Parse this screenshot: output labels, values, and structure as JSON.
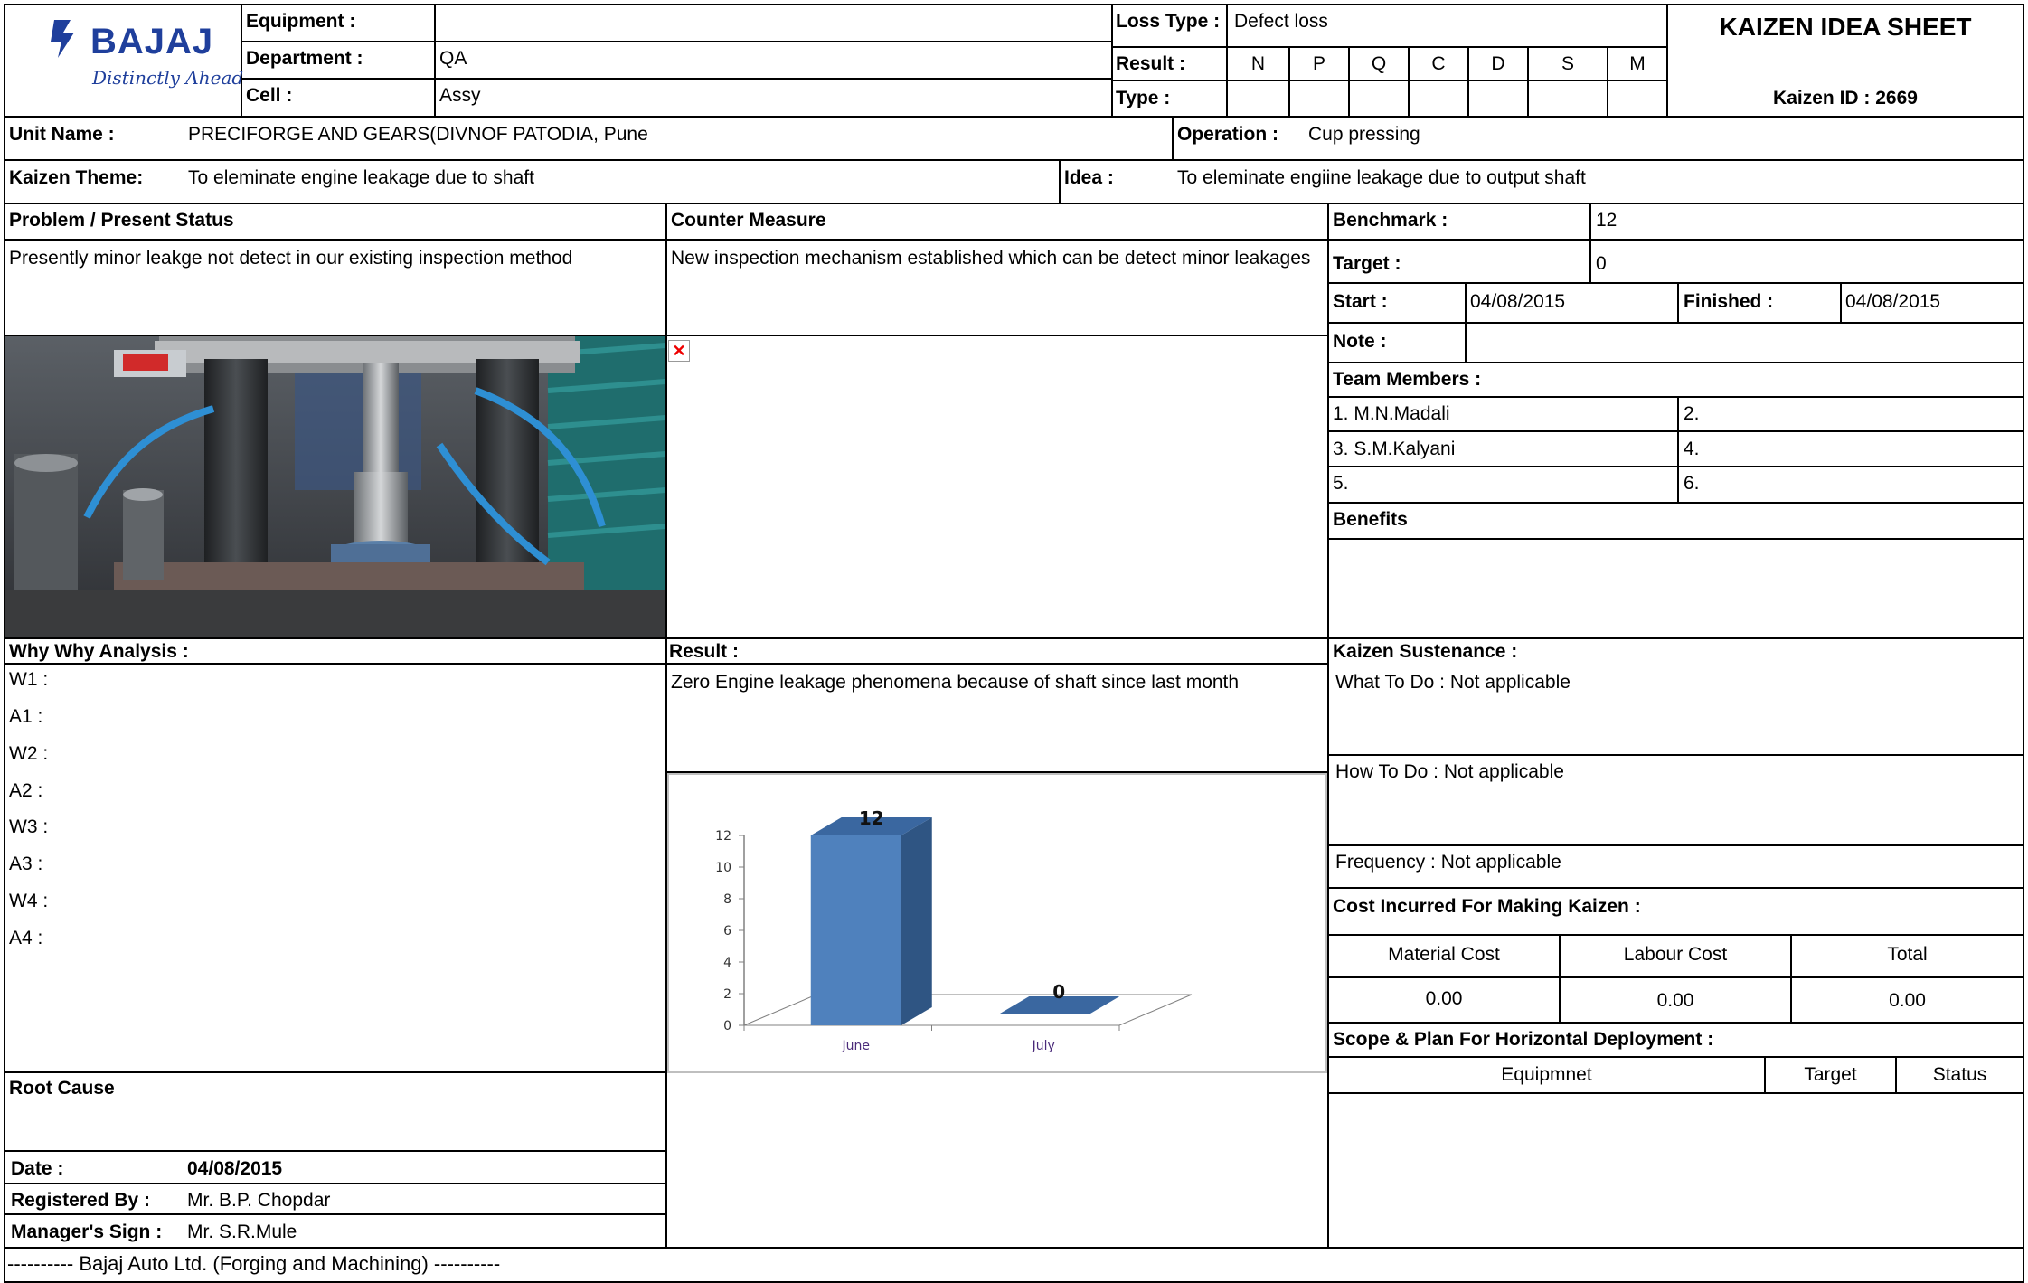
{
  "header": {
    "logo_text": "BAJAJ",
    "logo_tagline": "Distinctly Ahead",
    "equipment_label": "Equipment :",
    "equipment_value": "",
    "department_label": "Department :",
    "department_value": "QA",
    "cell_label": "Cell :",
    "cell_value": "Assy",
    "loss_type_label": "Loss Type :",
    "loss_type_value": "Defect loss",
    "result_label": "Result :",
    "type_label": "Type :",
    "result_categories": [
      "N",
      "P",
      "Q",
      "C",
      "D",
      "S",
      "M"
    ],
    "title": "KAIZEN IDEA SHEET",
    "kaizen_id": "Kaizen ID : 2669"
  },
  "unit": {
    "label": "Unit Name :",
    "value": "PRECIFORGE AND GEARS(DIVNOF PATODIA, Pune",
    "operation_label": "Operation :",
    "operation_value": "Cup pressing"
  },
  "theme": {
    "label": "Kaizen Theme:",
    "value": "To eleminate engine leakage due to shaft",
    "idea_label": "Idea :",
    "idea_value": "To eleminate engiine leakage due to output shaft"
  },
  "problem": {
    "label": "Problem / Present Status",
    "value": "Presently minor leakge not detect in our existing inspection method"
  },
  "counter": {
    "label": "Counter Measure",
    "value": "New inspection mechanism established which can be detect minor leakages"
  },
  "benchmark": {
    "label": "Benchmark :",
    "value": "12"
  },
  "target": {
    "label": "Target :",
    "value": "0"
  },
  "start": {
    "label": "Start :",
    "value": "04/08/2015"
  },
  "finished": {
    "label": "Finished :",
    "value": "04/08/2015"
  },
  "note": {
    "label": "Note :",
    "value": ""
  },
  "team": {
    "label": "Team Members :",
    "members": [
      "1. M.N.Madali",
      "2.",
      "3. S.M.Kalyani",
      "4.",
      "5.",
      "6."
    ]
  },
  "benefits": {
    "label": "Benefits"
  },
  "why": {
    "label": "Why Why Analysis :",
    "rows": [
      "W1 :",
      "A1 :",
      "W2 :",
      "A2 :",
      "W3 :",
      "A3 :",
      "W4 :",
      "A4 :"
    ]
  },
  "result": {
    "label": "Result :",
    "value": "Zero  Engine leakage phenomena because of shaft since last month"
  },
  "sustenance": {
    "label": "Kaizen Sustenance :",
    "what": "What To Do : Not applicable",
    "how": "How To Do : Not applicable",
    "frequency": "Frequency : Not applicable"
  },
  "cost": {
    "label": "Cost Incurred For Making Kaizen  :",
    "headers": [
      "Material Cost",
      "Labour Cost",
      "Total"
    ],
    "values": [
      "0.00",
      "0.00",
      "0.00"
    ]
  },
  "scope": {
    "label": "Scope & Plan For Horizontal Deployment :",
    "headers": [
      "Equipmnet",
      "Target",
      "Status"
    ]
  },
  "root_cause": {
    "label": "Root Cause"
  },
  "date": {
    "label": "Date :",
    "value": "04/08/2015"
  },
  "registered": {
    "label": "Registered By :",
    "value": "Mr. B.P. Chopdar"
  },
  "manager": {
    "label": "Manager's Sign :",
    "value": "Mr. S.R.Mule"
  },
  "footer": {
    "text": "---------- Bajaj Auto Ltd. (Forging and Machining)    ----------"
  },
  "broken_image_icon": "broken-image-icon",
  "colors": {
    "bar_front": "#4f81bd",
    "bar_side": "#2f5583",
    "bar_top": "#3a67a0",
    "axis": "#808080"
  },
  "chart_data": {
    "type": "bar",
    "categories": [
      "June",
      "July"
    ],
    "values": [
      12,
      0
    ],
    "title": "",
    "xlabel": "",
    "ylabel": "",
    "ylim": [
      0,
      12
    ],
    "yticks": [
      0,
      2,
      4,
      6,
      8,
      10,
      12
    ],
    "data_labels": true,
    "legend": "none",
    "grid": false
  }
}
